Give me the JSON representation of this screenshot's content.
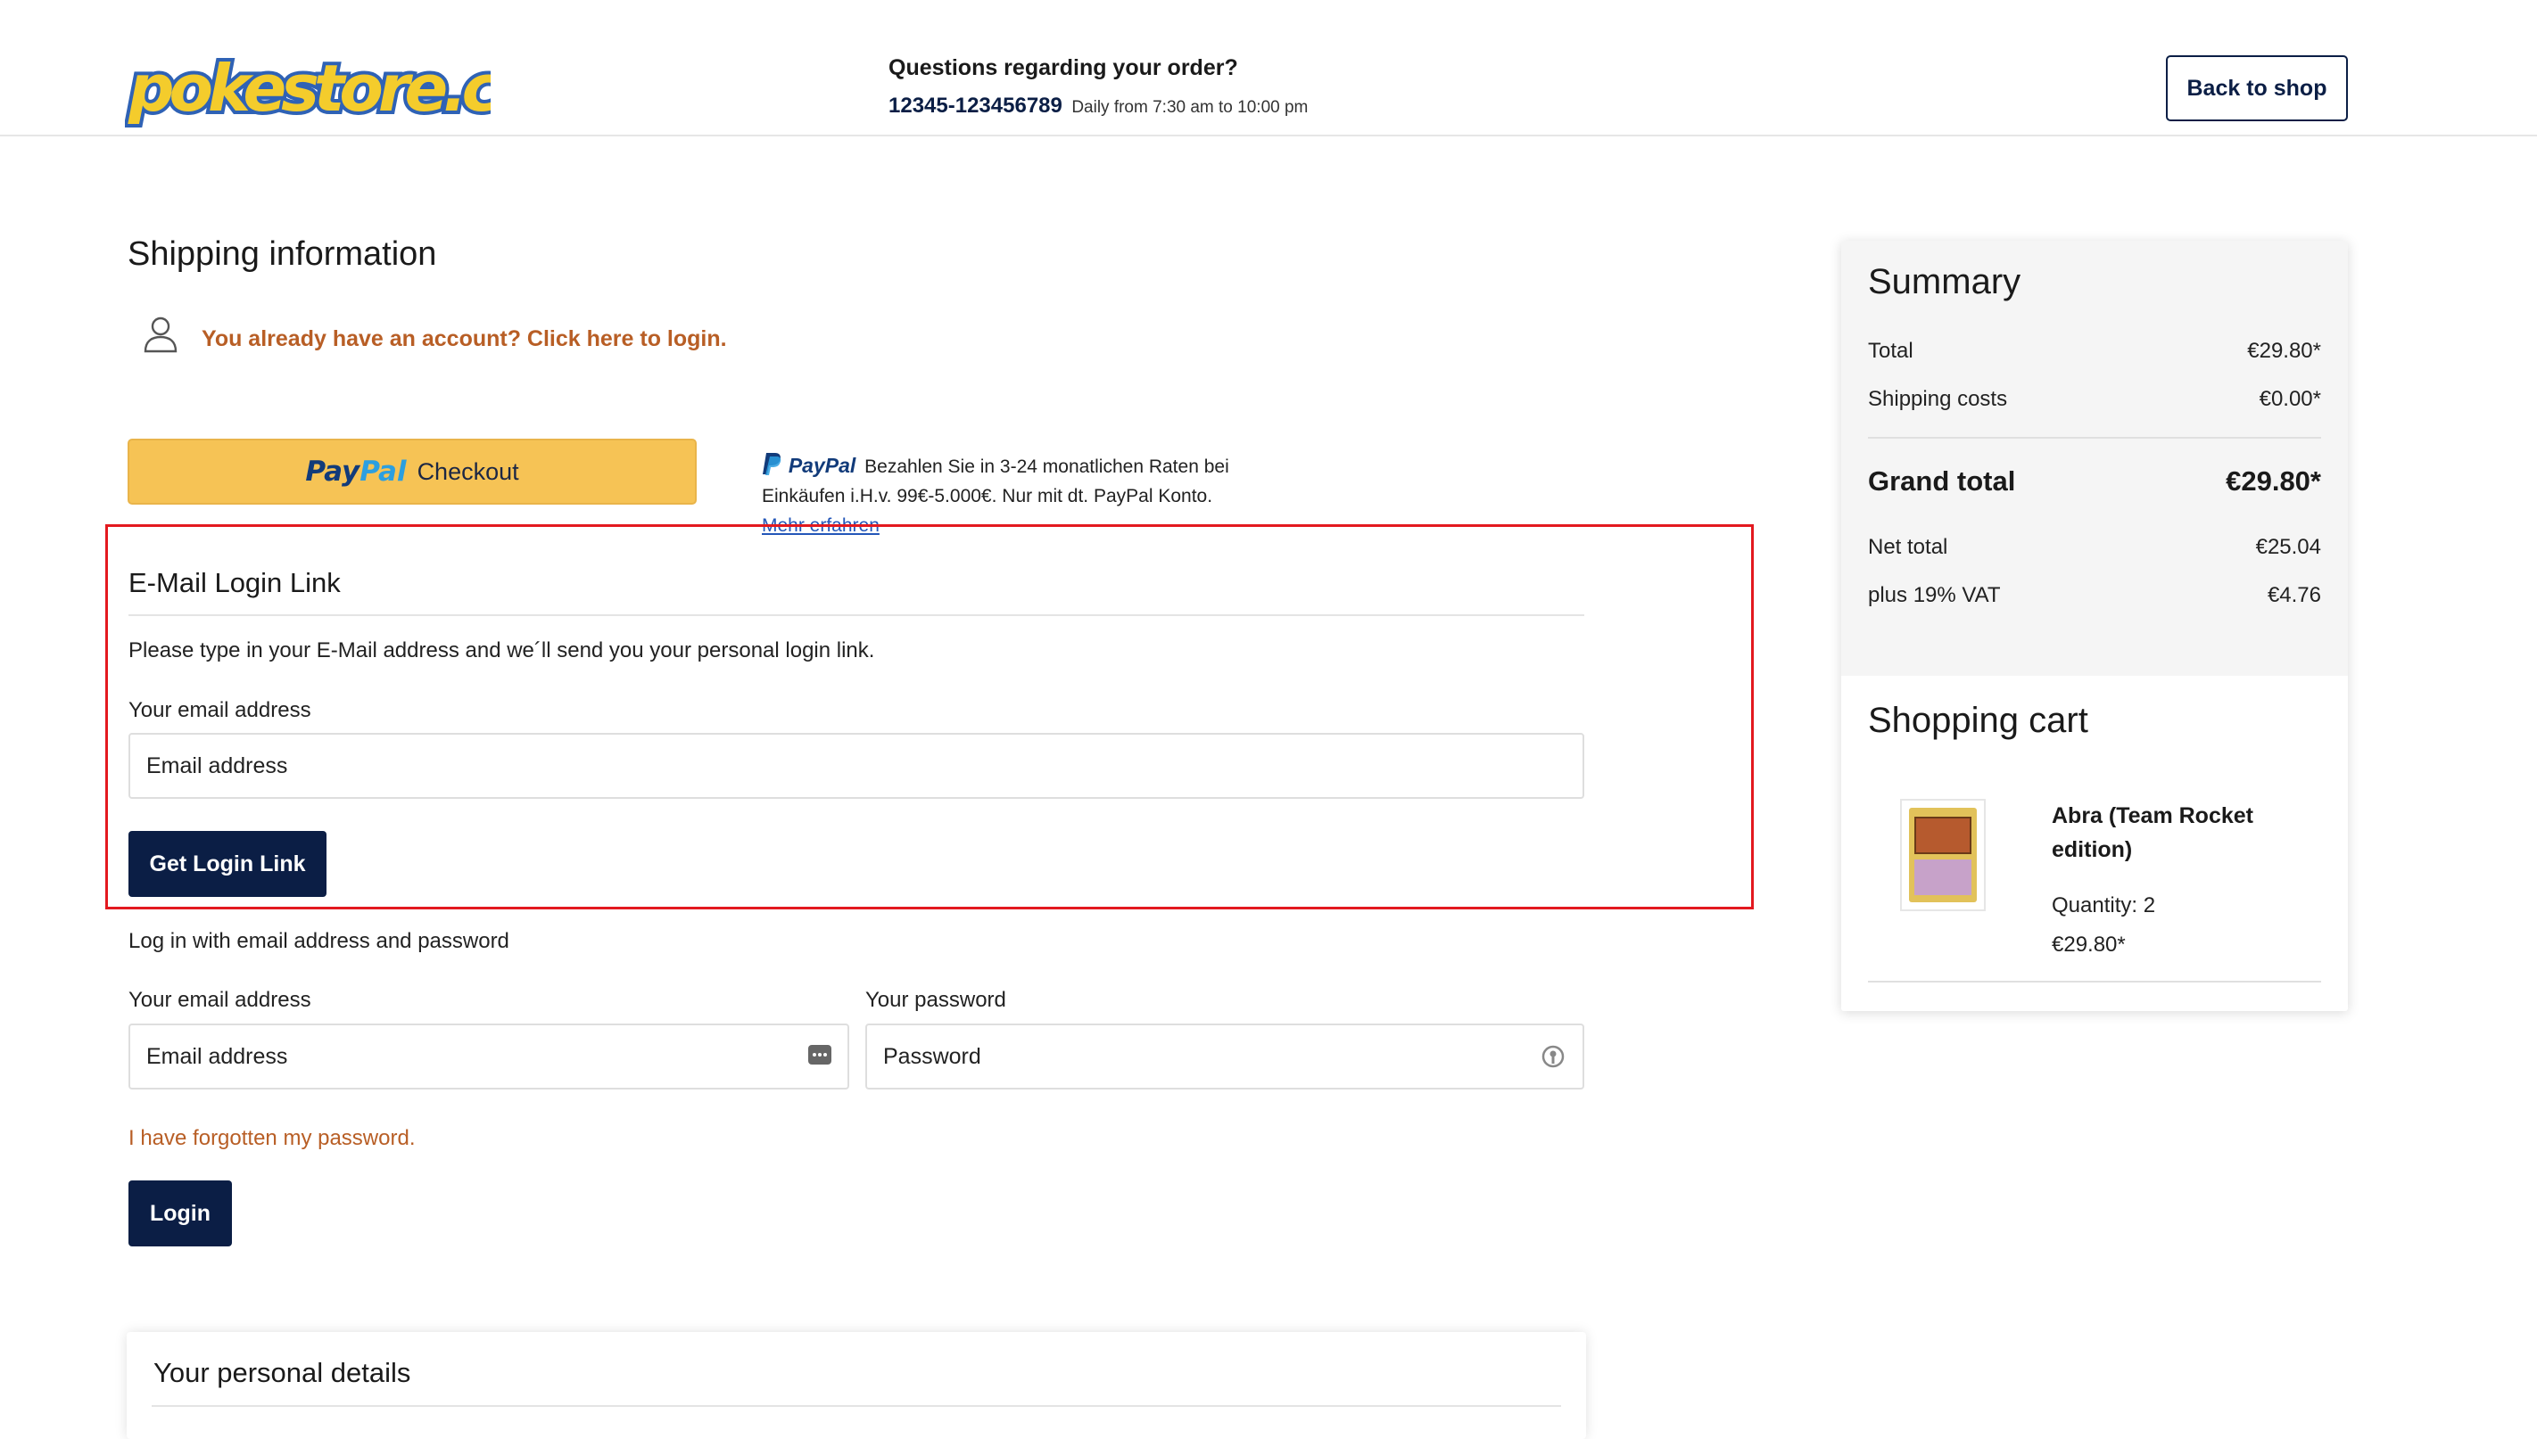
{
  "header": {
    "logo_text": "pokestore.com",
    "contact_question": "Questions regarding your order?",
    "phone": "12345-123456789",
    "hours": "Daily from 7:30 am to 10:00 pm",
    "back_label": "Back to shop"
  },
  "shipping": {
    "title": "Shipping information",
    "login_prompt": "You already have an account? Click here to login."
  },
  "paypal": {
    "brand_part1": "Pay",
    "brand_part2": "Pal",
    "checkout_label": "Checkout",
    "mini_brand": "PayPal",
    "info_text": "Bezahlen Sie in 3-24 monatlichen Raten bei Einkäufen i.H.v. 99€-5.000€. Nur mit dt. PayPal Konto.",
    "more_link": "Mehr erfahren",
    "button_color": "#f6c355"
  },
  "email_login": {
    "title": "E-Mail Login Link",
    "description": "Please type in your E-Mail address and we´ll send you your personal login link.",
    "email_label": "Your email address",
    "email_placeholder": "Email address",
    "button_label": "Get Login Link"
  },
  "password_login": {
    "title": "Log in with email address and password",
    "email_label": "Your email address",
    "email_placeholder": "Email address",
    "password_label": "Your password",
    "password_placeholder": "Password",
    "forgot_label": "I have forgotten my password.",
    "button_label": "Login"
  },
  "personal_details": {
    "title": "Your personal details"
  },
  "summary": {
    "title": "Summary",
    "total_label": "Total",
    "total_value": "€29.80*",
    "shipping_label": "Shipping costs",
    "shipping_value": "€0.00*",
    "grand_label": "Grand total",
    "grand_value": "€29.80*",
    "net_label": "Net total",
    "net_value": "€25.04",
    "vat_label": "plus 19% VAT",
    "vat_value": "€4.76"
  },
  "cart": {
    "title": "Shopping cart",
    "items": [
      {
        "name": "Abra (Team Rocket edition)",
        "quantity": "Quantity: 2",
        "price": "€29.80*"
      }
    ]
  },
  "colors": {
    "primary_dark": "#0b1e45",
    "link_orange": "#b85e25",
    "highlight_red": "#e3191f"
  }
}
